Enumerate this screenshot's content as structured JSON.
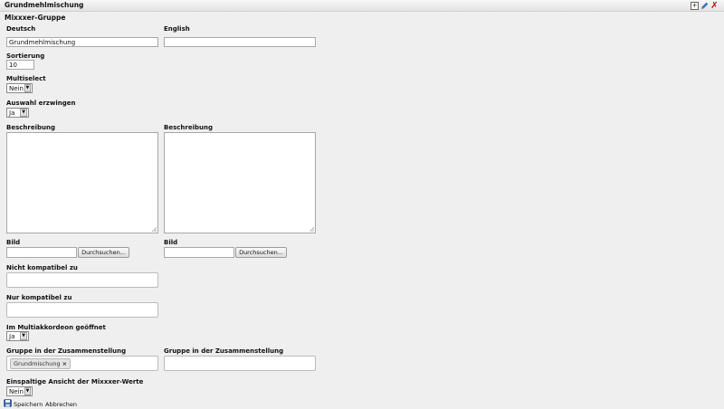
{
  "header": {
    "title": "Grundmehlmischung",
    "add_icon": "+",
    "edit_icon": "pencil-icon",
    "close_icon": "✗",
    "close_color": "#d40000"
  },
  "form": {
    "section_title": "Mixxxer-Gruppe",
    "lang_de": "Deutsch",
    "lang_en": "English",
    "name_de_value": "Grundmehlmischung",
    "name_en_value": "",
    "sort_label": "Sortierung",
    "sort_value": "10",
    "multiselect_label": "Multiselect",
    "multiselect_value": "Nein",
    "force_label": "Auswahl erzwingen",
    "force_value": "Ja",
    "desc_label_de": "Beschreibung",
    "desc_label_en": "Beschreibung",
    "image_label_de": "Bild",
    "image_label_en": "Bild",
    "browse_label": "Durchsuchen...",
    "incompatible_label": "Nicht kompatibel zu",
    "only_compatible_label": "Nur kompatibel zu",
    "accordion_label": "Im Multiakkordeon geöffnet",
    "accordion_value": "Ja",
    "group_label_de": "Gruppe in der Zusammenstellung",
    "group_label_en": "Gruppe in der Zusammenstellung",
    "group_tag": "Grundmischung",
    "group_tag_remove": "×",
    "single_column_label": "Einspaltige Ansicht der Mixxxer-Werte",
    "single_column_value": "Nein"
  },
  "footer": {
    "save_label": "Speichern",
    "cancel_label": "Abbrechen"
  }
}
